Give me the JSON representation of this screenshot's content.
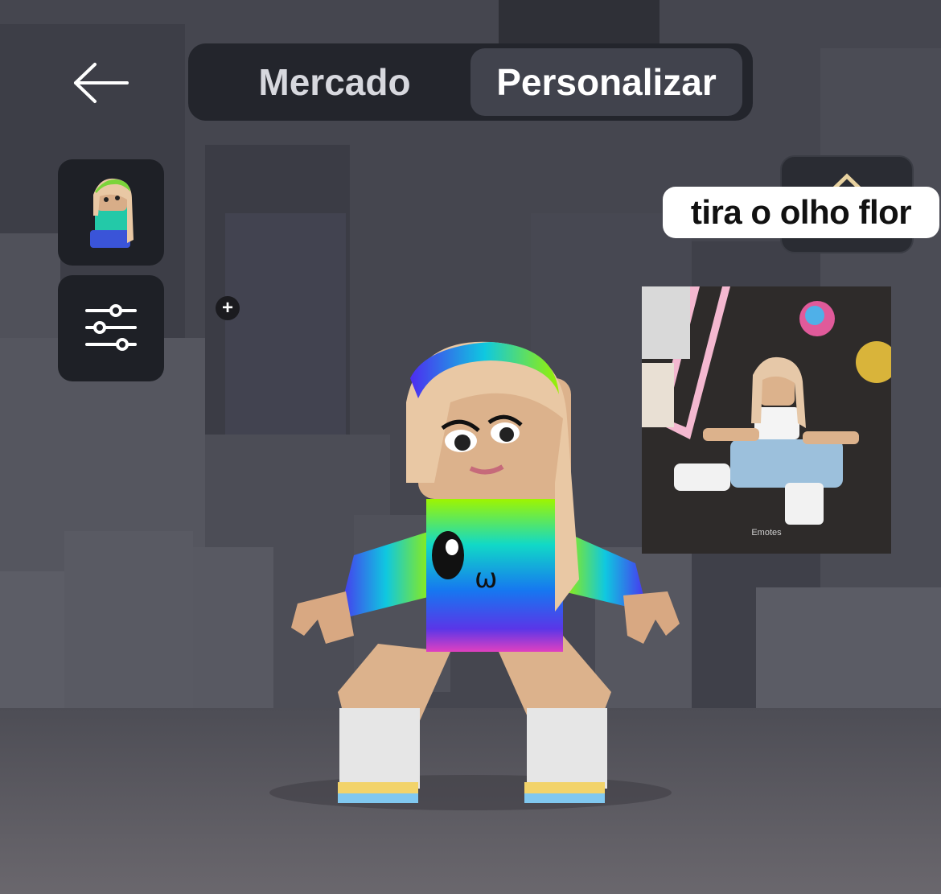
{
  "nav": {
    "back_icon": "arrow-left-icon",
    "tabs": [
      {
        "label": "Mercado",
        "selected": false
      },
      {
        "label": "Personalizar",
        "selected": true
      }
    ]
  },
  "sidebar": {
    "avatar_button_icon": "avatar-thumbnail",
    "filters_button_icon": "sliders-icon"
  },
  "right_button_icon": "shirt-hanger-icon",
  "caption": "tira o olho flor",
  "inset": {
    "label": "Emotes",
    "plus": "+"
  },
  "colors": {
    "nav_bg": "#23252c",
    "tab_selected_bg": "#41434d",
    "scene_bg": "#4a4b55",
    "floor": "#5a5960"
  }
}
